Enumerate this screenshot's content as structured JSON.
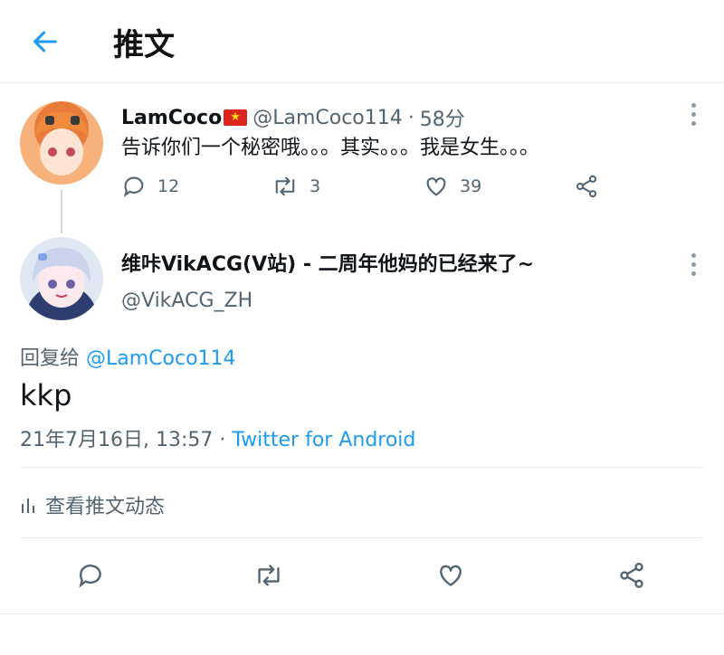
{
  "header": {
    "title": "推文",
    "back_icon": "arrow-left-icon",
    "accent": "#1d9bf0"
  },
  "parent_tweet": {
    "display_name": "LamCoco",
    "flag_emoji": "★",
    "handle": "@LamCoco114",
    "separator": "·",
    "time": "58分",
    "text": "告诉你们一个秘密哦。。。其实。。。我是女生。。。",
    "reply_count": "12",
    "retweet_count": "3",
    "like_count": "39"
  },
  "main_tweet": {
    "display_name": "维咔VikACG(V站) - 二周年他妈的已经来了~",
    "handle": "@VikACG_ZH",
    "reply_prefix": "回复给 ",
    "reply_to": "@LamCoco114",
    "text": "kkp",
    "timestamp": "21年7月16日, 13:57",
    "meta_sep": " · ",
    "source": "Twitter for Android"
  },
  "activity": {
    "label": "查看推文动态",
    "icon": "bar-chart-icon"
  }
}
